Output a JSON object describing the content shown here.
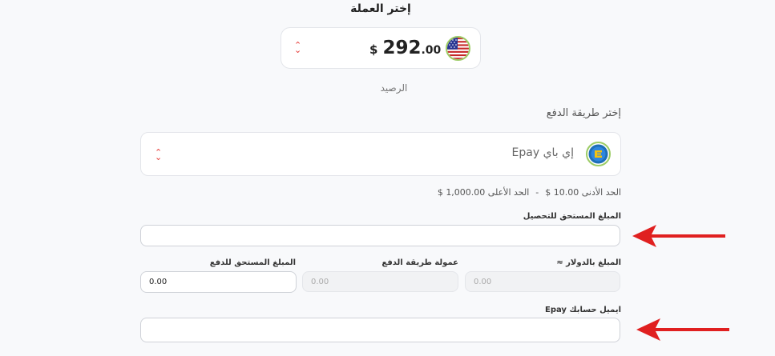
{
  "currency_section": {
    "title": "إختر العملة",
    "symbol": "$",
    "amount_whole": "292",
    "amount_decimal": ".00",
    "balance_label": "الرصيد"
  },
  "payment_method": {
    "title": "إختر طريقة الدفع",
    "selected": "إي باي Epay",
    "limits": {
      "min": "الحد الأدنى 10.00 $",
      "separator": "-",
      "max": "الحد الأعلى 1,000.00 $"
    }
  },
  "fields": {
    "amount_due_collect": {
      "label": "المبلغ المستحق للتحصيل",
      "value": ""
    },
    "amount_usd": {
      "label": "المبلغ بالدولار ≈",
      "value": "0.00"
    },
    "payment_fee": {
      "label": "عمولة طريقة الدفع",
      "value": "0.00"
    },
    "amount_due_pay": {
      "label": "المبلغ المستحق للدفع",
      "value": "0.00"
    },
    "account_email": {
      "label": "ايميل حسابك Epay",
      "value": ""
    }
  },
  "colors": {
    "accent_red": "#e02020",
    "flag_ring": "#9ccc65",
    "epay_blue": "#1e6fb8",
    "epay_green": "#8bc34a"
  }
}
